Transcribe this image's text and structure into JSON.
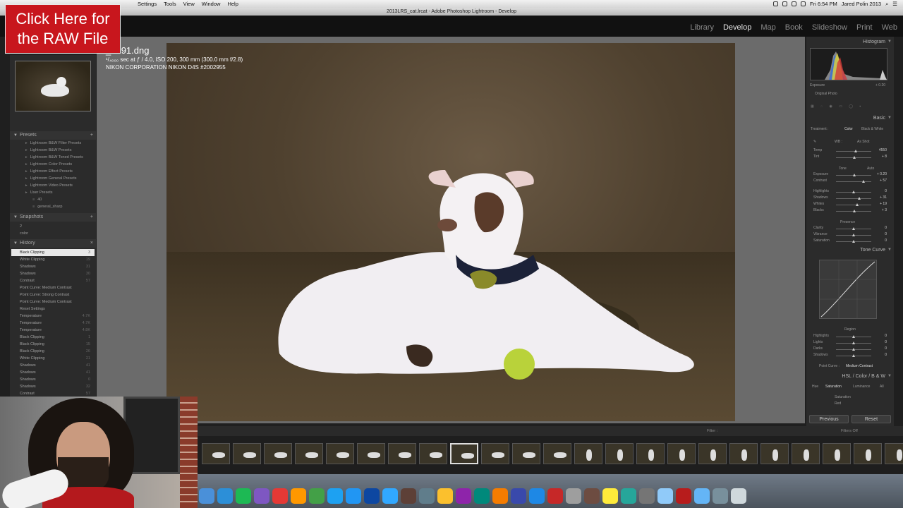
{
  "menubar": {
    "items": [
      "Settings",
      "Tools",
      "View",
      "Window",
      "Help"
    ],
    "time": "Fri 6:54 PM",
    "user": "Jared Polin 2013"
  },
  "window_title": "2013LRS_cat.lrcat - Adobe Photoshop Lightroom - Develop",
  "promo": {
    "text": "Click Here for the RAW File"
  },
  "modules": [
    "Library",
    "Develop",
    "Map",
    "Book",
    "Slideshow",
    "Print",
    "Web"
  ],
  "photo_info": {
    "filename": "_0191.dng",
    "exif": "¹/₄₀₀₀ sec at ƒ / 4.0, ISO 200, 300 mm (300.0 mm f/2.8)",
    "camera": "NIKON CORPORATION NIKON D4S #2002955"
  },
  "left": {
    "presets_header": "Presets",
    "presets": [
      "Lightroom B&W Filter Presets",
      "Lightroom B&W Presets",
      "Lightroom B&W Toned Presets",
      "Lightroom Color Presets",
      "Lightroom Effect Presets",
      "Lightroom General Presets",
      "Lightroom Video Presets",
      "User Presets",
      "40",
      "general_sharp"
    ],
    "snapshots_header": "Snapshots",
    "snapshots": [
      "2",
      "color"
    ],
    "history_header": "History",
    "history": [
      {
        "label": "Black Clipping",
        "v1": "+3",
        "v2": "3"
      },
      {
        "label": "White Clipping",
        "v1": "+19",
        "v2": "19"
      },
      {
        "label": "Shadows",
        "v1": "-11",
        "v2": "31"
      },
      {
        "label": "Shadows",
        "v1": "+20",
        "v2": "30"
      },
      {
        "label": "Contrast",
        "v1": "+17",
        "v2": "57"
      },
      {
        "label": "Point Curve: Medium Contrast",
        "v1": "",
        "v2": ""
      },
      {
        "label": "Point Curve: Strong Contrast",
        "v1": "",
        "v2": ""
      },
      {
        "label": "Point Curve: Medium Contrast",
        "v1": "",
        "v2": ""
      },
      {
        "label": "Reset Settings",
        "v1": "",
        "v2": ""
      },
      {
        "label": "Temperature",
        "v1": "",
        "v2": "4.7K"
      },
      {
        "label": "Temperature",
        "v1": "-163",
        "v2": "4.7K"
      },
      {
        "label": "Temperature",
        "v1": "+297",
        "v2": "4.8K"
      },
      {
        "label": "Black Clipping",
        "v1": "-14",
        "v2": "1"
      },
      {
        "label": "Black Clipping",
        "v1": "",
        "v2": "15"
      },
      {
        "label": "Black Clipping",
        "v1": "+15",
        "v2": "26"
      },
      {
        "label": "White Clipping",
        "v1": "+21",
        "v2": "21"
      },
      {
        "label": "Shadows",
        "v1": "",
        "v2": "41"
      },
      {
        "label": "Shadows",
        "v1": "+41",
        "v2": "41"
      },
      {
        "label": "Shadows",
        "v1": "",
        "v2": "0"
      },
      {
        "label": "Shadows",
        "v1": "+32",
        "v2": "32"
      },
      {
        "label": "Contrast",
        "v1": "+57",
        "v2": "57"
      }
    ]
  },
  "right": {
    "histogram_header": "Histogram",
    "exposure_label": "Exposure",
    "exposure_value": "+ 0.20",
    "original_photo": "Original Photo",
    "basic_header": "Basic",
    "treatment_label": "Treatment :",
    "treatment_color": "Color",
    "treatment_bw": "Black & White",
    "wb_label": "WB :",
    "wb_value": "As Shot",
    "tone_label": "Tone",
    "auto_label": "Auto",
    "presence_label": "Presence",
    "sliders": [
      {
        "label": "Temp",
        "value": "4550",
        "pos": 0.55
      },
      {
        "label": "Tint",
        "value": "+ 8",
        "pos": 0.52
      },
      {
        "label": "Exposure",
        "value": "+ 0.20",
        "pos": 0.52
      },
      {
        "label": "Contrast",
        "value": "+ 57",
        "pos": 0.78
      },
      {
        "label": "Highlights",
        "value": "0",
        "pos": 0.5
      },
      {
        "label": "Shadows",
        "value": "+ 31",
        "pos": 0.65
      },
      {
        "label": "Whites",
        "value": "+ 19",
        "pos": 0.6
      },
      {
        "label": "Blacks",
        "value": "+ 3",
        "pos": 0.52
      },
      {
        "label": "Clarity",
        "value": "0",
        "pos": 0.5
      },
      {
        "label": "Vibrance",
        "value": "0",
        "pos": 0.5
      },
      {
        "label": "Saturation",
        "value": "0",
        "pos": 0.5
      }
    ],
    "tone_curve_header": "Tone Curve",
    "region_label": "Region",
    "region_sliders": [
      {
        "label": "Highlights",
        "value": "0"
      },
      {
        "label": "Lights",
        "value": "0"
      },
      {
        "label": "Darks",
        "value": "0"
      },
      {
        "label": "Shadows",
        "value": "0"
      }
    ],
    "point_curve_label": "Point Curve :",
    "point_curve_value": "Medium Contrast",
    "hsl_header": "HSL / Color / B & W",
    "hsl_tabs": [
      "Hue",
      "Saturation",
      "Luminance",
      "All"
    ],
    "saturation_label": "Saturation",
    "red_label": "Red",
    "previous": "Previous",
    "reset": "Reset"
  },
  "filmbar": {
    "filter_label": "Filter :",
    "filters_off": "Filters Off"
  },
  "colors": {
    "promo": "#c8161d",
    "panel": "#2b2b2b",
    "active_module": "#e6e6e6"
  }
}
